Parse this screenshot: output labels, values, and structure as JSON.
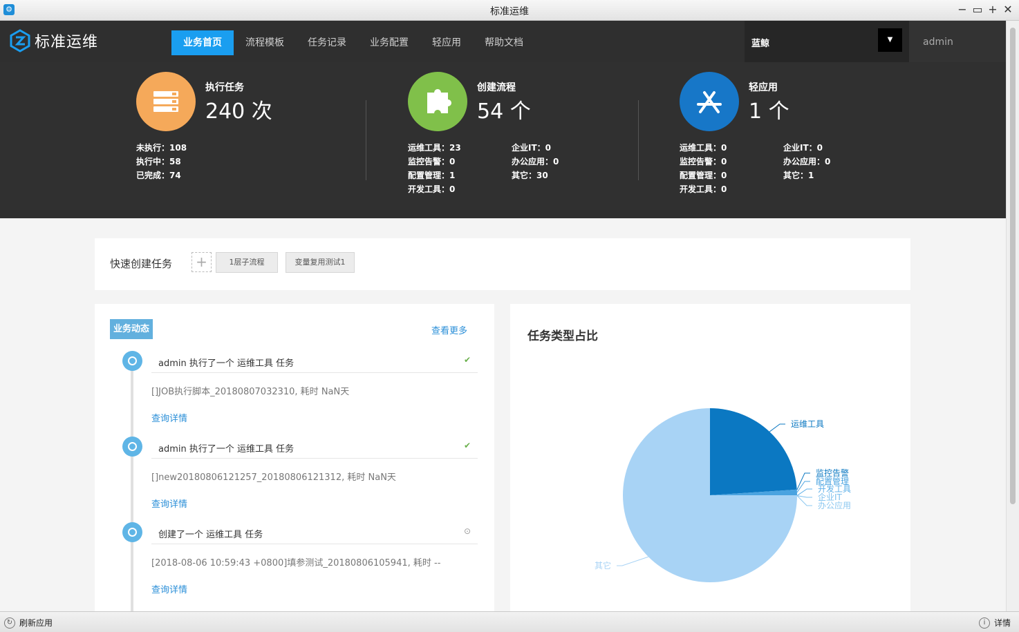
{
  "window": {
    "title": "标准运维"
  },
  "nav": {
    "logo_text": "标准运维",
    "menu": [
      "业务首页",
      "流程模板",
      "任务记录",
      "业务配置",
      "轻应用",
      "帮助文档"
    ],
    "active_index": 0,
    "business": "蓝鲸",
    "user": "admin"
  },
  "stats": {
    "tasks": {
      "label": "执行任务",
      "value": "240 次",
      "color": "#f5a95a",
      "lines": [
        "未执行：108",
        "执行中：58",
        "已完成：74"
      ]
    },
    "flows": {
      "label": "创建流程",
      "value": "54 个",
      "color": "#80c04a",
      "col1": [
        "运维工具：23",
        "监控告警：0",
        "配置管理：1",
        "开发工具：0"
      ],
      "col2": [
        "企业IT：0",
        "办公应用：0",
        "其它：30"
      ]
    },
    "apps": {
      "label": "轻应用",
      "value": "1 个",
      "color": "#1777c8",
      "col1": [
        "运维工具：0",
        "监控告警：0",
        "配置管理：0",
        "开发工具：0"
      ],
      "col2": [
        "企业IT：0",
        "办公应用：0",
        "其它：1"
      ]
    }
  },
  "quick": {
    "label": "快速创建任务",
    "add_symbol": "+",
    "templates": [
      "1层子流程",
      "变量复用测试1"
    ]
  },
  "activity": {
    "title": "业务动态",
    "more": "查看更多",
    "items": [
      {
        "title": "admin 执行了一个 运维工具 任务",
        "desc": "[]JOB执行脚本_20180807032310, 耗时 NaN天",
        "link": "查询详情",
        "status": "✔",
        "status_color": "#6ab04c"
      },
      {
        "title": "admin 执行了一个 运维工具 任务",
        "desc": "[]new20180806121257_20180806121312, 耗时 NaN天",
        "link": "查询详情",
        "status": "✔",
        "status_color": "#6ab04c"
      },
      {
        "title": "创建了一个 运维工具 任务",
        "desc": "[2018-08-06 10:59:43 +0800]填参测试_20180806105941, 耗时 --",
        "link": "查询详情",
        "status": "⊙",
        "status_color": "#999999"
      }
    ]
  },
  "chart_data": {
    "type": "pie",
    "title": "任务类型占比",
    "slices": [
      {
        "name": "运维工具",
        "value": 23,
        "color": "#0b78c2"
      },
      {
        "name": "监控告警",
        "value": 0,
        "color": "#0b78c2"
      },
      {
        "name": "配置管理",
        "value": 1,
        "color": "#4aa3e0"
      },
      {
        "name": "开发工具",
        "value": 0,
        "color": "#5fb0e8"
      },
      {
        "name": "企业IT",
        "value": 0,
        "color": "#7dc0ee"
      },
      {
        "name": "办公应用",
        "value": 0,
        "color": "#8dc8f0"
      },
      {
        "name": "其它",
        "value": 72,
        "color": "#a8d3f5"
      }
    ]
  },
  "statusbar": {
    "refresh": "刷新应用",
    "detail": "详情"
  }
}
